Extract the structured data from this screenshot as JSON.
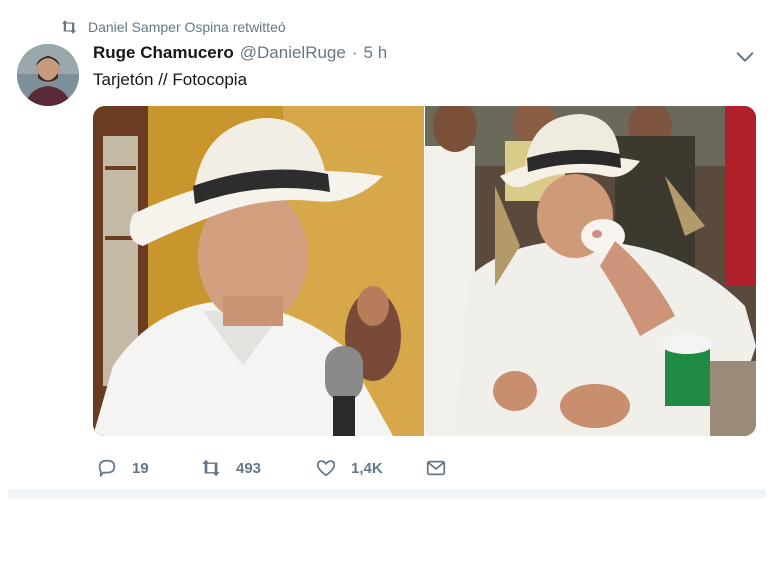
{
  "retweet_header": {
    "icon": "retweet-icon",
    "text": "Daniel Samper Ospina retwitteó"
  },
  "author": {
    "display_name": "Ruge Chamucero",
    "handle": "@DanielRuge",
    "separator": "·",
    "time": "5 h",
    "avatar_icon": "avatar"
  },
  "menu_icon": "chevron-down-icon",
  "tweet": {
    "text": "Tarjetón // Fotocopia"
  },
  "media": {
    "left_photo": "photo-man-white-hat-microphone",
    "right_photo": "photo-man-white-hat-drinking-cup"
  },
  "actions": {
    "reply": {
      "icon": "reply-icon",
      "count": "19"
    },
    "retweet": {
      "icon": "retweet-icon",
      "count": "493"
    },
    "like": {
      "icon": "heart-icon",
      "count": "1,4K"
    },
    "message": {
      "icon": "envelope-icon"
    }
  },
  "colors": {
    "text_primary": "#14171a",
    "text_secondary": "#657786",
    "separator": "#e6ecf0"
  }
}
